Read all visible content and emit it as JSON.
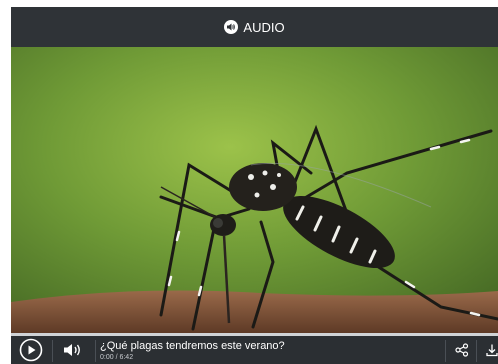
{
  "header": {
    "label": "AUDIO",
    "icon": "speaker-icon"
  },
  "media": {
    "subject": "mosquito-image"
  },
  "player": {
    "progress_fraction": 0.0,
    "progress_color": "#e05a2b",
    "background_color": "#2b2f33"
  },
  "controls": {
    "play_icon": "play-icon",
    "volume_icon": "volume-icon",
    "title": "¿Qué plagas tendremos este verano?",
    "time": "0:00 / 6:42",
    "share_icon": "share-icon",
    "download_icon": "download-icon"
  }
}
